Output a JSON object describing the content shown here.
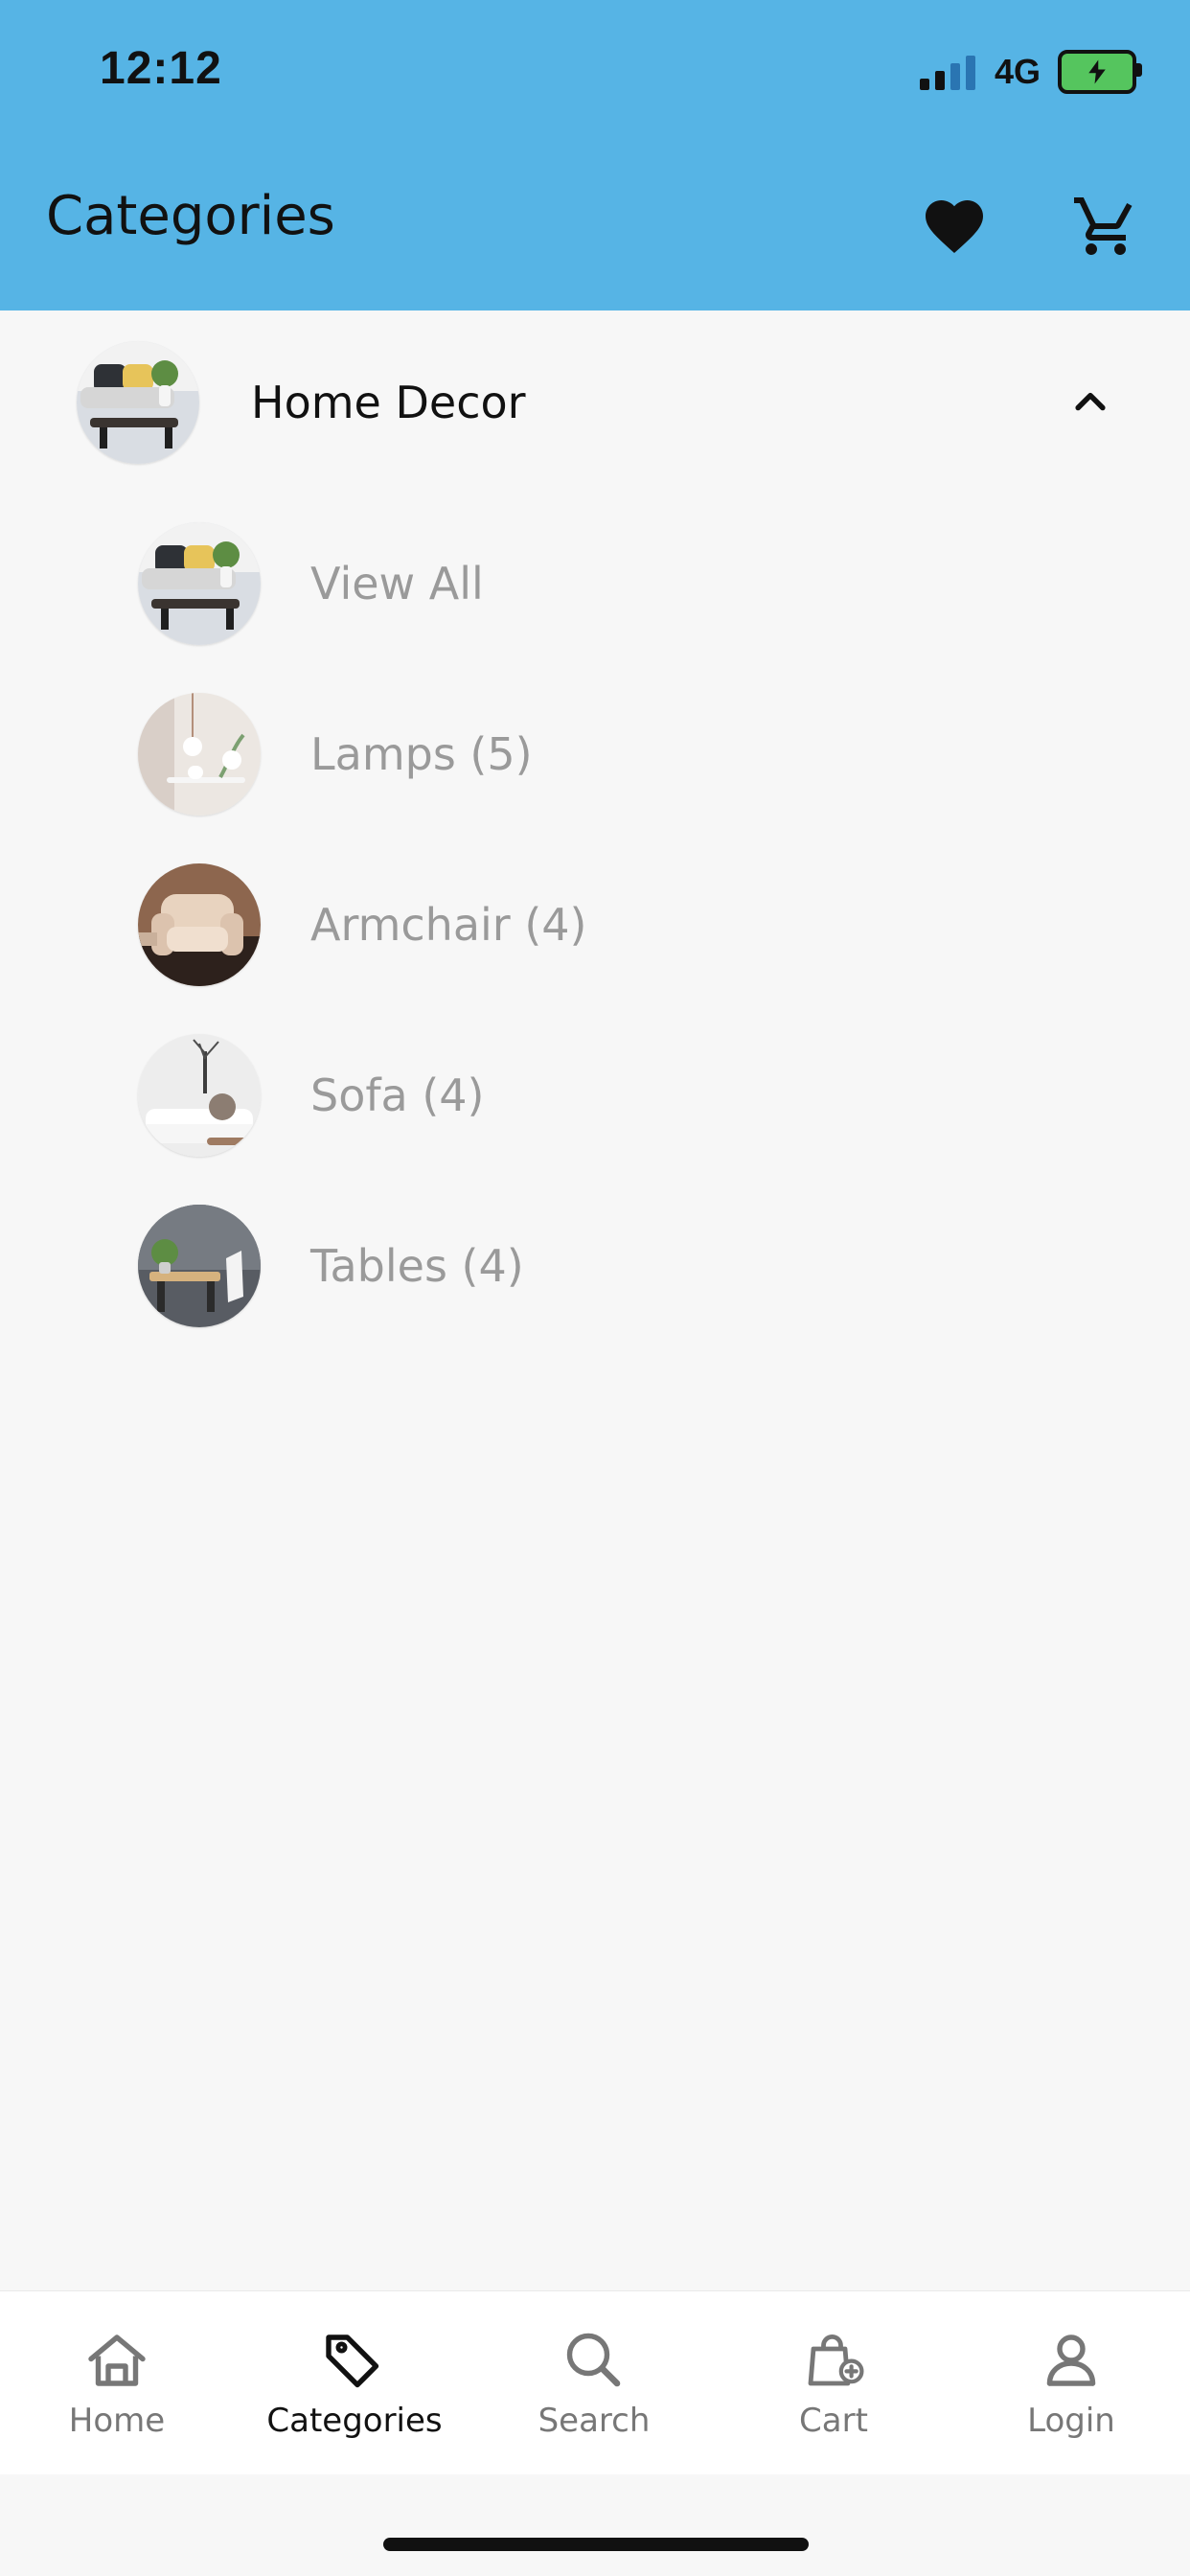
{
  "status_bar": {
    "time": "12:12",
    "network": "4G",
    "signal_icon": "signal-icon",
    "battery_icon": "battery-charging-icon"
  },
  "header": {
    "title": "Categories",
    "background_color": "#56b4e5",
    "favorite_icon": "heart-icon",
    "cart_icon": "shopping-cart-icon"
  },
  "categories": {
    "parent": {
      "label": "Home Decor",
      "expanded": true,
      "toggle_icon": "chevron-up-icon"
    },
    "children": [
      {
        "label": "View All"
      },
      {
        "label": "Lamps (5)"
      },
      {
        "label": "Armchair (4)"
      },
      {
        "label": "Sofa (4)"
      },
      {
        "label": "Tables (4)"
      }
    ]
  },
  "bottom_nav": {
    "items": [
      {
        "label": "Home",
        "icon": "home-icon"
      },
      {
        "label": "Categories",
        "icon": "tag-icon",
        "active": true
      },
      {
        "label": "Search",
        "icon": "search-icon"
      },
      {
        "label": "Cart",
        "icon": "shopping-bag-plus-icon"
      },
      {
        "label": "Login",
        "icon": "user-icon"
      }
    ]
  }
}
